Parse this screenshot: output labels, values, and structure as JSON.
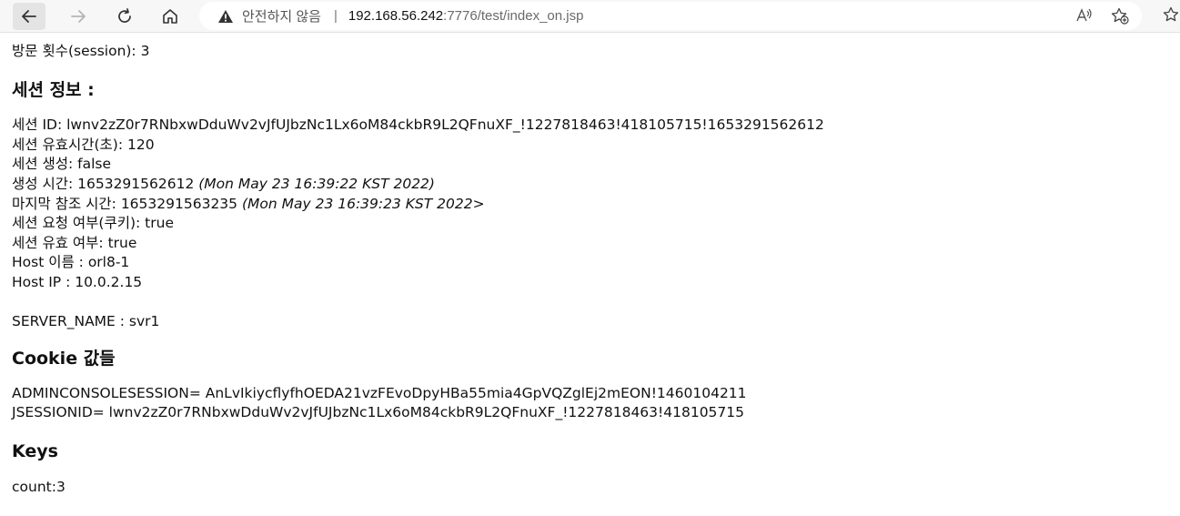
{
  "browser": {
    "security_label": "안전하지 않음",
    "separator": "|",
    "url_host": "192.168.56.242",
    "url_path": ":7776/test/index_on.jsp",
    "icons": [
      "back-arrow-icon",
      "forward-arrow-icon",
      "reload-icon",
      "home-icon",
      "warning-triangle-icon",
      "read-aloud-icon",
      "add-favorite-icon",
      "favorites-icon"
    ]
  },
  "page": {
    "visit_count": "방문 횟수(session): 3",
    "session_heading": "세션 정보 :",
    "session": {
      "id": "세션 ID: lwnv2zZ0r7RNbxwDduWv2vJfUJbzNc1Lx6oM84ckbR9L2QFnuXF_!1227818463!418105715!1653291562612",
      "timeout": "세션 유효시간(초): 120",
      "is_new": "세션 생성: false",
      "created_label": "생성 시간: 1653291562612 ",
      "created_date": "(Mon May 23 16:39:22 KST 2022)",
      "last_access_label": "마지막 참조 시간: 1653291563235 ",
      "last_access_date": "(Mon May 23 16:39:23 KST 2022>",
      "from_cookie": "세션 요청 여부(쿠키): true",
      "valid": "세션 유효 여부: true",
      "host_name": "Host 이름 : orl8-1",
      "host_ip": "Host IP : 10.0.2.15",
      "server_name": "SERVER_NAME : svr1"
    },
    "cookie_heading": "Cookie 값들",
    "cookies": [
      "ADMINCONSOLESESSION= AnLvIkiycflyfhOEDA21vzFEvoDpyHBa55mia4GpVQZglEj2mEON!1460104211",
      "JSESSIONID= lwnv2zZ0r7RNbxwDduWv2vJfUJbzNc1Lx6oM84ckbR9L2QFnuXF_!1227818463!418105715"
    ],
    "keys_heading": "Keys",
    "keys": [
      "count:3"
    ]
  }
}
